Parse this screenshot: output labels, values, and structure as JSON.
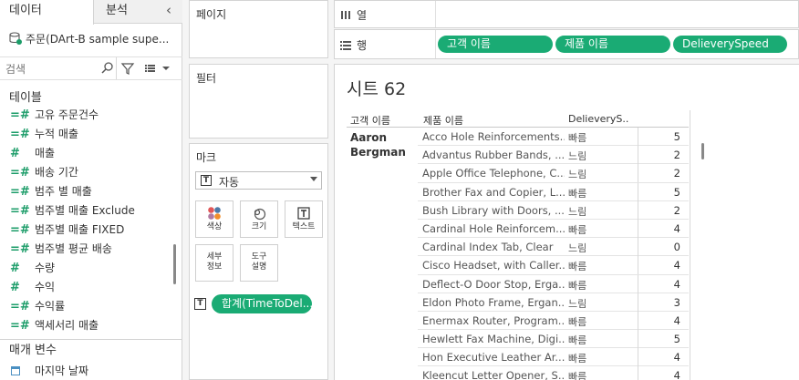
{
  "left_pane": {
    "tabs": [
      {
        "label": "데이터"
      },
      {
        "label": "분석"
      }
    ],
    "collapse_glyph": "‹",
    "datasource": "주문(DArt-B sample supe...",
    "search_placeholder": "검색",
    "tables_header": "테이블",
    "fields": [
      {
        "label": "고유 주문건수"
      },
      {
        "label": "누적 매출"
      },
      {
        "label": "매출"
      },
      {
        "label": "배송 기간"
      },
      {
        "label": "범주 별 매출"
      },
      {
        "label": "범주별 매출 Exclude"
      },
      {
        "label": "범주별 매출 FIXED"
      },
      {
        "label": "범주별 평균 배송"
      },
      {
        "label": "수량"
      },
      {
        "label": "수익"
      },
      {
        "label": "수익률"
      },
      {
        "label": "액세서리 매출"
      }
    ],
    "params_header": "매개 변수",
    "param_item": "마지막 날짜"
  },
  "cards": {
    "pages_title": "페이지",
    "filters_title": "필터",
    "marks_title": "마크",
    "mark_type": "자동",
    "mark_buttons": {
      "color": "색상",
      "size": "크기",
      "text": "텍스트",
      "detail_1": "세부",
      "detail_2": "정보",
      "tooltip_1": "도구",
      "tooltip_2": "설명"
    },
    "text_pill": "합계(TimeToDel..."
  },
  "shelves": {
    "columns_label": "열",
    "rows_label": "행",
    "row_pills": [
      "고객 이름",
      "제품 이름",
      "DelieverySpeed"
    ]
  },
  "view": {
    "sheet_title": "시트 62",
    "headers": {
      "customer": "고객 이름",
      "product": "제품 이름",
      "speed": "DelieveryS.."
    },
    "customer_line1": "Aaron",
    "customer_line2": "Bergman",
    "rows": [
      {
        "product": "Acco Hole Reinforcements...",
        "speed": "빠름",
        "value": "5"
      },
      {
        "product": "Advantus Rubber Bands, ...",
        "speed": "느림",
        "value": "2"
      },
      {
        "product": "Apple Office Telephone, C...",
        "speed": "느림",
        "value": "2"
      },
      {
        "product": "Brother Fax and Copier, L...",
        "speed": "빠름",
        "value": "5"
      },
      {
        "product": "Bush Library with Doors, ...",
        "speed": "느림",
        "value": "2"
      },
      {
        "product": "Cardinal Hole Reinforcem...",
        "speed": "빠름",
        "value": "4"
      },
      {
        "product": "Cardinal Index Tab, Clear",
        "speed": "느림",
        "value": "0"
      },
      {
        "product": "Cisco Headset, with Caller...",
        "speed": "빠름",
        "value": "4"
      },
      {
        "product": "Deflect-O Door Stop, Erga...",
        "speed": "빠름",
        "value": "4"
      },
      {
        "product": "Eldon Photo Frame, Ergan...",
        "speed": "느림",
        "value": "3"
      },
      {
        "product": "Enermax Router, Program...",
        "speed": "빠름",
        "value": "4"
      },
      {
        "product": "Hewlett Fax Machine, Digi...",
        "speed": "빠름",
        "value": "5"
      },
      {
        "product": "Hon Executive Leather Ar...",
        "speed": "빠름",
        "value": "4"
      },
      {
        "product": "Kleencut Letter Opener, S...",
        "speed": "빠름",
        "value": "4"
      }
    ]
  },
  "colors": {
    "pill_green": "#1aab74",
    "measure_green": "#1b9c68"
  }
}
